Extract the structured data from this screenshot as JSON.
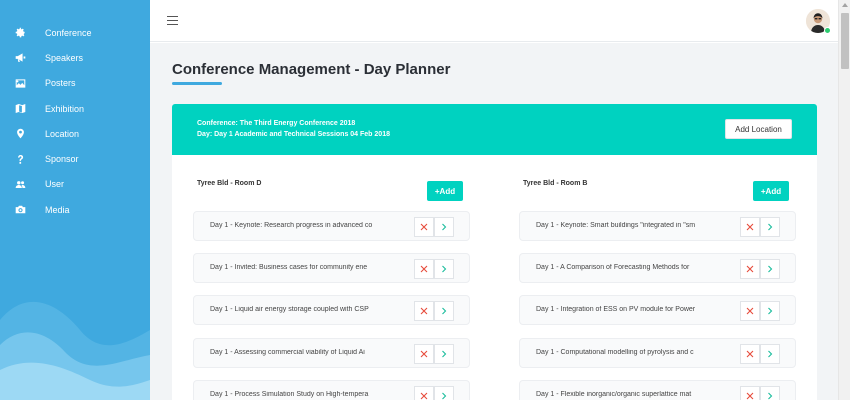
{
  "sidebar": {
    "items": [
      {
        "label": "Conference",
        "icon": "gear-icon"
      },
      {
        "label": "Speakers",
        "icon": "megaphone-icon"
      },
      {
        "label": "Posters",
        "icon": "image-icon"
      },
      {
        "label": "Exhibition",
        "icon": "map-icon"
      },
      {
        "label": "Location",
        "icon": "map-marker-icon"
      },
      {
        "label": "Sponsor",
        "icon": "question-icon"
      },
      {
        "label": "User",
        "icon": "users-icon"
      },
      {
        "label": "Media",
        "icon": "camera-icon"
      }
    ]
  },
  "header": {
    "menu_icon": "hamburger-icon",
    "avatar_status": "online"
  },
  "page": {
    "title": "Conference Management - Day Planner"
  },
  "banner": {
    "conference_line": "Conference: The Third Energy Conference 2018",
    "day_line": "Day: Day 1 Academic and Technical Sessions 04 Feb 2018",
    "add_location_label": "Add Location"
  },
  "locations": [
    {
      "name": "Tyree Bld - Room D",
      "add_label": "+Add",
      "sessions": [
        "Day 1 - Keynote: Research progress in advanced co",
        "Day 1 - Invited: Business cases for community ene",
        "Day 1 - Liquid air energy storage coupled with CSP",
        "Day 1 - Assessing commercial viability of Liquid Ai",
        "Day 1 - Process Simulation Study on High-tempera"
      ]
    },
    {
      "name": "Tyree Bld - Room B",
      "add_label": "+Add",
      "sessions": [
        "Day 1 - Keynote: Smart buildings \"integrated in \"sm",
        "Day 1 - A Comparison of Forecasting Methods for",
        "Day 1 - Integration of ESS on PV module for Power",
        "Day 1 - Computational modelling of pyrolysis and c",
        "Day 1 - Flexible inorganic/organic superlattice mat"
      ]
    }
  ],
  "row_actions": {
    "delete_icon": "close-icon",
    "open_icon": "chevron-right-icon"
  },
  "colors": {
    "sidebar": "#3fa9df",
    "accent_teal": "#00d2c0",
    "delete_red": "#e74c3c",
    "open_green": "#1abc9c",
    "background": "#f2f4f6"
  }
}
